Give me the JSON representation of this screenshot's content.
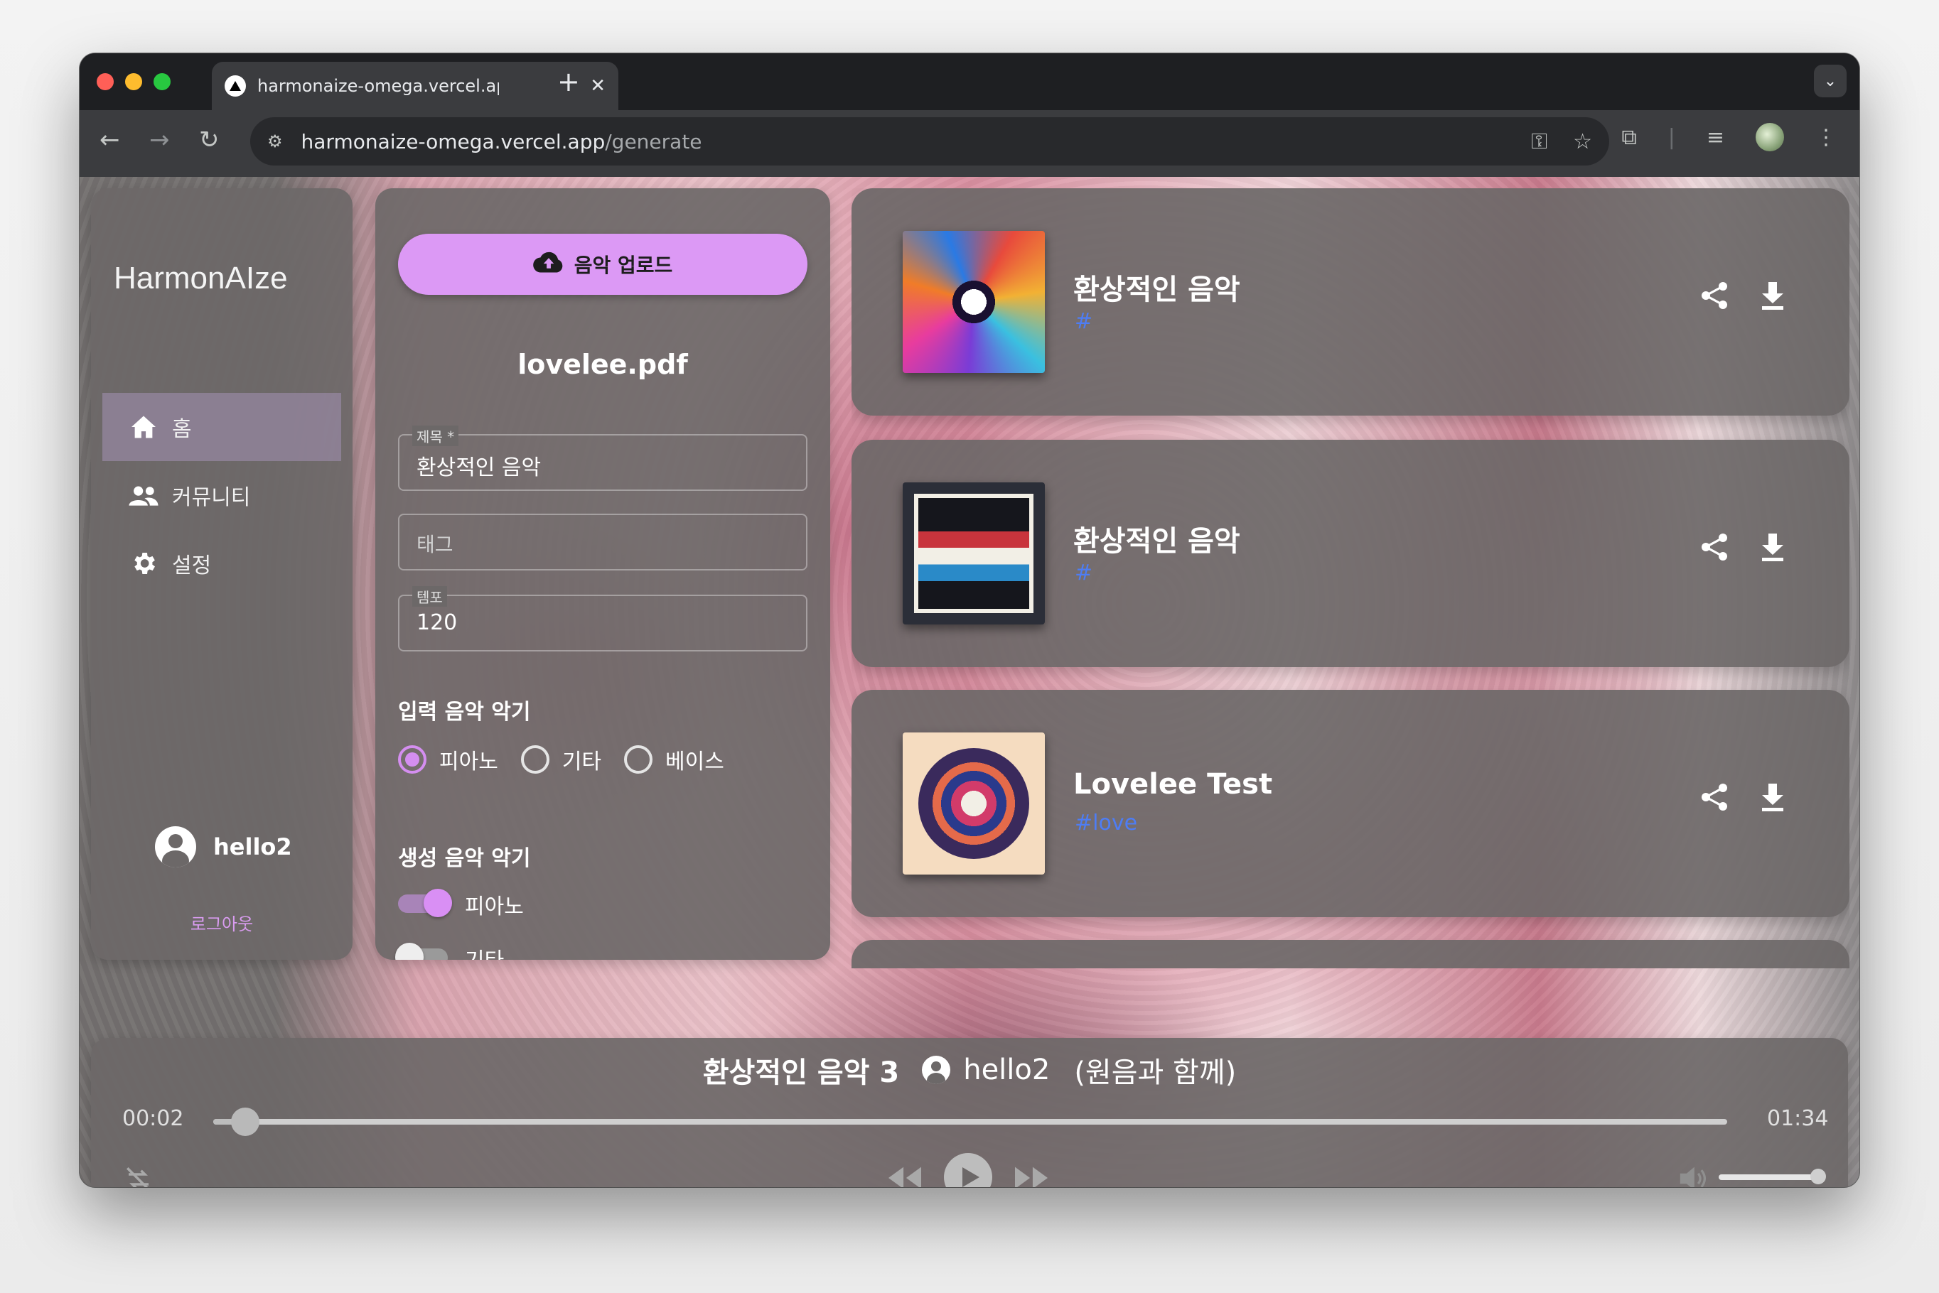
{
  "browser": {
    "tab_title": "harmonaize-omega.vercel.app/generate",
    "url_host": "harmonaize-omega.vercel.app",
    "url_path": "/generate"
  },
  "sidebar": {
    "app_title": "HarmonAIze",
    "items": [
      {
        "label": "홈",
        "icon": "home-icon",
        "active": true
      },
      {
        "label": "커뮤니티",
        "icon": "people-icon",
        "active": false
      },
      {
        "label": "설정",
        "icon": "gear-icon",
        "active": false
      }
    ],
    "username": "hello2",
    "logout_label": "로그아웃"
  },
  "form": {
    "upload_label": "음악 업로드",
    "filename": "lovelee.pdf",
    "title_label": "제목 *",
    "title_value": "환상적인 음악",
    "tag_placeholder": "태그",
    "tempo_label": "템포",
    "tempo_value": "120",
    "input_section": "입력 음악 악기",
    "input_options": [
      {
        "label": "피아노",
        "selected": true
      },
      {
        "label": "기타",
        "selected": false
      },
      {
        "label": "베이스",
        "selected": false
      }
    ],
    "output_section": "생성 음악 악기",
    "output_options": [
      {
        "label": "피아노",
        "on": true
      },
      {
        "label": "기타",
        "on": false
      }
    ]
  },
  "tracks": [
    {
      "title": "환상적인 음악",
      "tag": "#"
    },
    {
      "title": "환상적인 음악",
      "tag": "#"
    },
    {
      "title": "Lovelee Test",
      "tag": "#love"
    }
  ],
  "player": {
    "title": "환상적인 음악 3",
    "user": "hello2",
    "note": "(원음과 함께)",
    "elapsed": "00:02",
    "duration": "01:34",
    "progress": 0.021,
    "volume": 1.0
  },
  "colors": {
    "accent": "#dc99f5",
    "tag_blue": "#4e7df4",
    "panel": "#6c6868"
  }
}
